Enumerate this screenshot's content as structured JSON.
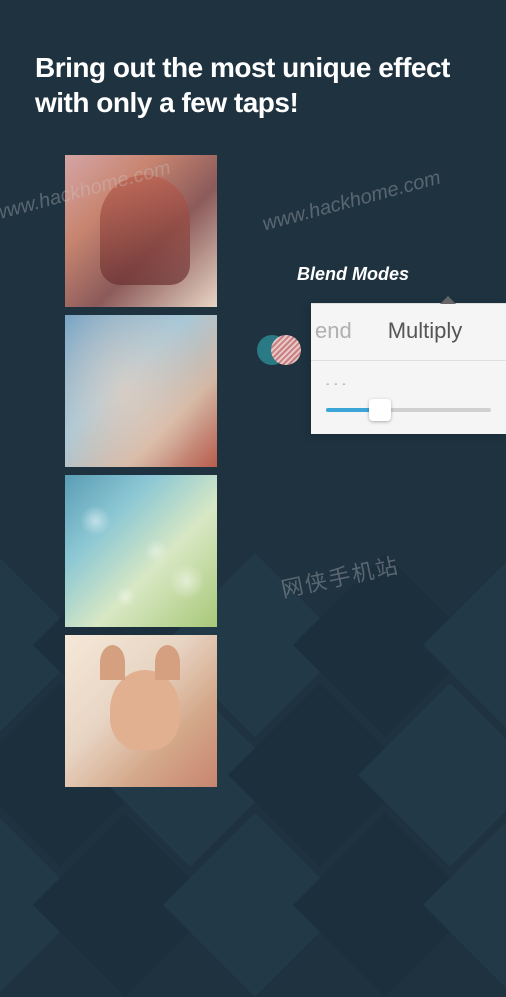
{
  "headline": {
    "line1": "Bring out the most unique effect",
    "line2": "with only a few taps!"
  },
  "callout": {
    "label": "Blend Modes"
  },
  "panel": {
    "tab_partial": "end",
    "tab_active": "Multiply",
    "slider_dots": "- - -"
  },
  "watermarks": {
    "url1": "www.hackhome.com",
    "url2": "www.hackhome.com",
    "chinese": "网侠手机站"
  }
}
